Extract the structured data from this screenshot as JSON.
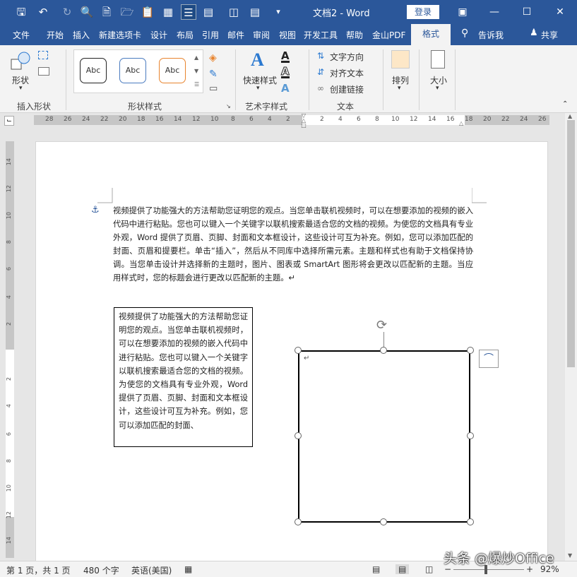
{
  "window": {
    "title": "文档2 - Word",
    "login_label": "登录"
  },
  "tabs": [
    "文件",
    "开始",
    "插入",
    "新建选项卡",
    "设计",
    "布局",
    "引用",
    "邮件",
    "审阅",
    "视图",
    "开发工具",
    "帮助",
    "金山PDF",
    "格式"
  ],
  "tell_me": "告诉我",
  "share": "共享",
  "ribbon": {
    "shape_label": "形状",
    "group_insert_shapes": "插入形状",
    "style_sample": "Abc",
    "group_shape_styles": "形状样式",
    "quick_styles": "快速样式",
    "group_wordart": "艺术字样式",
    "text_direction": "文字方向",
    "align_text": "对齐文本",
    "create_link": "创建链接",
    "group_text": "文本",
    "arrange": "排列",
    "size": "大小"
  },
  "ruler": {
    "h_left": [
      "28",
      "26",
      "24",
      "22",
      "20",
      "18",
      "16",
      "14",
      "12",
      "10",
      "8",
      "6",
      "4",
      "2"
    ],
    "h_right": [
      "2",
      "4",
      "6",
      "8",
      "10",
      "12",
      "14",
      "16",
      "18",
      "20",
      "22",
      "24",
      "26"
    ],
    "v": [
      "14",
      "12",
      "10",
      "8",
      "6",
      "4",
      "2",
      "2",
      "4",
      "6",
      "8",
      "10",
      "12",
      "14"
    ]
  },
  "document": {
    "paragraph": "视频提供了功能强大的方法帮助您证明您的观点。当您单击联机视频时，可以在想要添加的视频的嵌入代码中进行粘贴。您也可以键入一个关键字以联机搜索最适合您的文档的视频。为使您的文档具有专业外观，Word 提供了页眉、页脚、封面和文本框设计，这些设计可互为补充。例如，您可以添加匹配的封面、页眉和提要栏。单击“插入”，然后从不同库中选择所需元素。主题和样式也有助于文档保持协调。当您单击设计并选择新的主题时，图片、图表或 SmartArt 图形将会更改以匹配新的主题。当应用样式时，您的标题会进行更改以匹配新的主题。↵",
    "textbox": "视频提供了功能强大的方法帮助您证明您的观点。当您单击联机视频时，可以在想要添加的视频的嵌入代码中进行粘贴。您也可以键入一个关键字以联机搜索最适合您的文档的视频。为使您的文档具有专业外观，Word 提供了页眉、页脚、封面和文本框设计，这些设计可互为补充。例如，您可以添加匹配的封面、",
    "shape_mark": "↵"
  },
  "status": {
    "page": "第 1 页，共 1 页",
    "words": "480 个字",
    "language": "英语(美国)",
    "zoom": "92%"
  },
  "watermark": "头条 @爆炒Office",
  "colors": {
    "accent": "#2b579a",
    "ribbon": "#f3f3f3",
    "canvas": "#e6e6e6"
  }
}
